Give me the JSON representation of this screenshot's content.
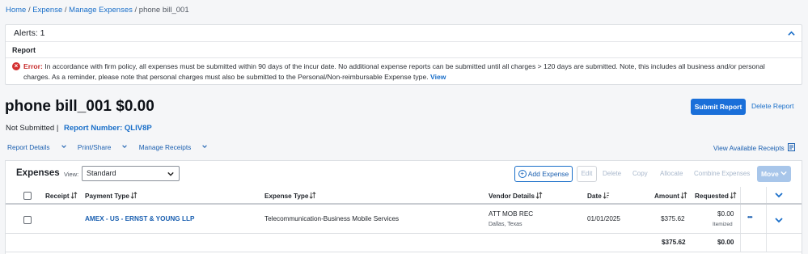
{
  "breadcrumb": {
    "items": [
      "Home",
      "Expense",
      "Manage Expenses"
    ],
    "current": "phone bill_001",
    "separator": "/"
  },
  "alerts": {
    "title": "Alerts: 1",
    "section": "Report",
    "error_label": "Error:",
    "message": "In accordance with firm policy, all expenses must be submitted within 90 days of the incur date. No additional expense reports can be submitted until all charges > 120 days are submitted. Note, this includes all business and/or personal charges. As a reminder, please note that personal charges must also be submitted to the Personal/Non-reimbursable Expense type.",
    "view_link": "View"
  },
  "report": {
    "title": "phone bill_001 $0.00",
    "submit_label": "Submit Report",
    "delete_label": "Delete Report",
    "status": "Not Submitted",
    "status_sep": "|",
    "report_number": "Report Number: QLIV8P"
  },
  "actions": {
    "report_details": "Report Details",
    "print_share": "Print/Share",
    "manage_receipts": "Manage Receipts",
    "view_available_receipts": "View Available Receipts"
  },
  "expenses": {
    "title": "Expenses",
    "view_label": "View:",
    "view_value": "Standard",
    "add_label": "Add Expense",
    "edit_label": "Edit",
    "delete_label": "Delete",
    "copy_label": "Copy",
    "allocate_label": "Allocate",
    "combine_label": "Combine Expenses",
    "move_label": "Move",
    "columns": {
      "receipt": "Receipt",
      "payment_type": "Payment Type",
      "expense_type": "Expense Type",
      "vendor": "Vendor Details",
      "date": "Date",
      "amount": "Amount",
      "requested": "Requested"
    },
    "rows": [
      {
        "payment_type": "AMEX - US - ERNST & YOUNG LLP",
        "expense_type": "Telecommunication-Business Mobile Services",
        "vendor": "ATT MOB REC",
        "vendor_location": "Dallas, Texas",
        "date": "01/01/2025",
        "amount": "$375.62",
        "requested": "$0.00",
        "requested_note": "Itemized",
        "more": "•••"
      }
    ],
    "totals": {
      "amount": "$375.62",
      "requested": "$0.00"
    }
  },
  "colors": {
    "link": "#1a6fc9",
    "primary_button": "#1a6fd9",
    "error": "#d32f2f",
    "disabled": "#a9b8cc"
  }
}
